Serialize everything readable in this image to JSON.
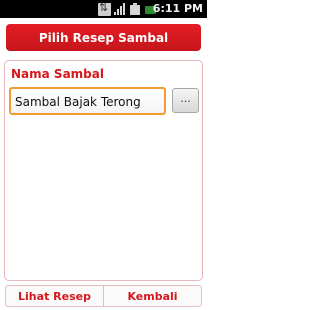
{
  "status_bar": {
    "time": "6:11 PM",
    "icons": [
      "data-transfer-icon",
      "signal-icon",
      "battery-icon",
      "charging-icon"
    ]
  },
  "header": {
    "title": "Pilih Resep Sambal"
  },
  "form": {
    "label": "Nama Sambal",
    "value": "Sambal Bajak Terong",
    "browse_label": "..."
  },
  "footer": {
    "left_button": "Lihat Resep",
    "right_button": "Kembali"
  },
  "colors": {
    "accent": "#d4181e",
    "input_focus": "#f29b32"
  }
}
